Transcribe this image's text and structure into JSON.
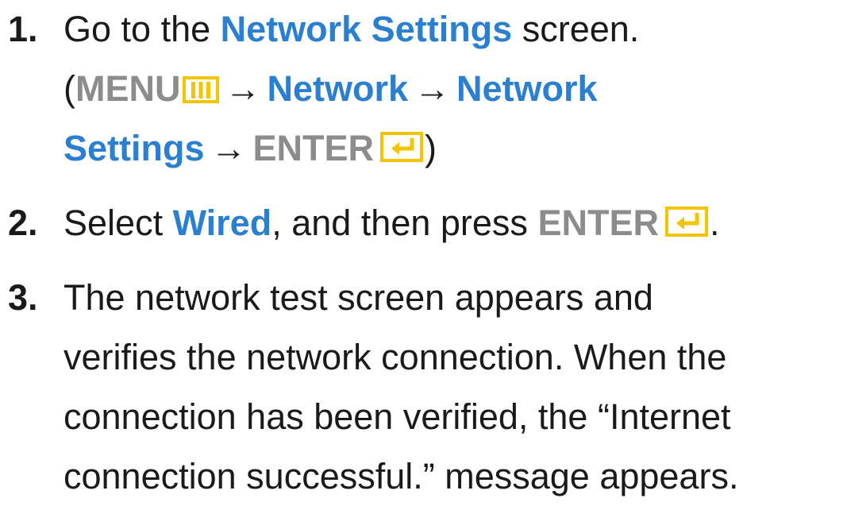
{
  "steps": [
    {
      "number": "1.",
      "line1": {
        "pre": "Go to the",
        "highlight": "Network Settings",
        "post": "screen."
      },
      "line2": {
        "open_paren": "(",
        "menu": "MENU",
        "arrow": "→",
        "network": "Network",
        "network2": "Network"
      },
      "line3": {
        "settings": "Settings",
        "enter": "ENTER",
        "close_paren": ")"
      }
    },
    {
      "number": "2.",
      "pre": "Select",
      "highlight": "Wired",
      "mid": ", and then press",
      "enter": "ENTER",
      "post": "."
    },
    {
      "number": "3.",
      "lines": [
        "The network test screen appears and",
        "verifies the network connection. When the",
        "connection has been verified, the “Internet",
        "connection successful.” message appears."
      ]
    }
  ],
  "icons": {
    "menu": "menu-icon",
    "enter": "enter-icon"
  },
  "colors": {
    "text": "#1a1a1a",
    "highlight_blue": "#2a7fd0",
    "button_gray": "#8c8c8c",
    "icon_yellow": "#f5c400"
  }
}
